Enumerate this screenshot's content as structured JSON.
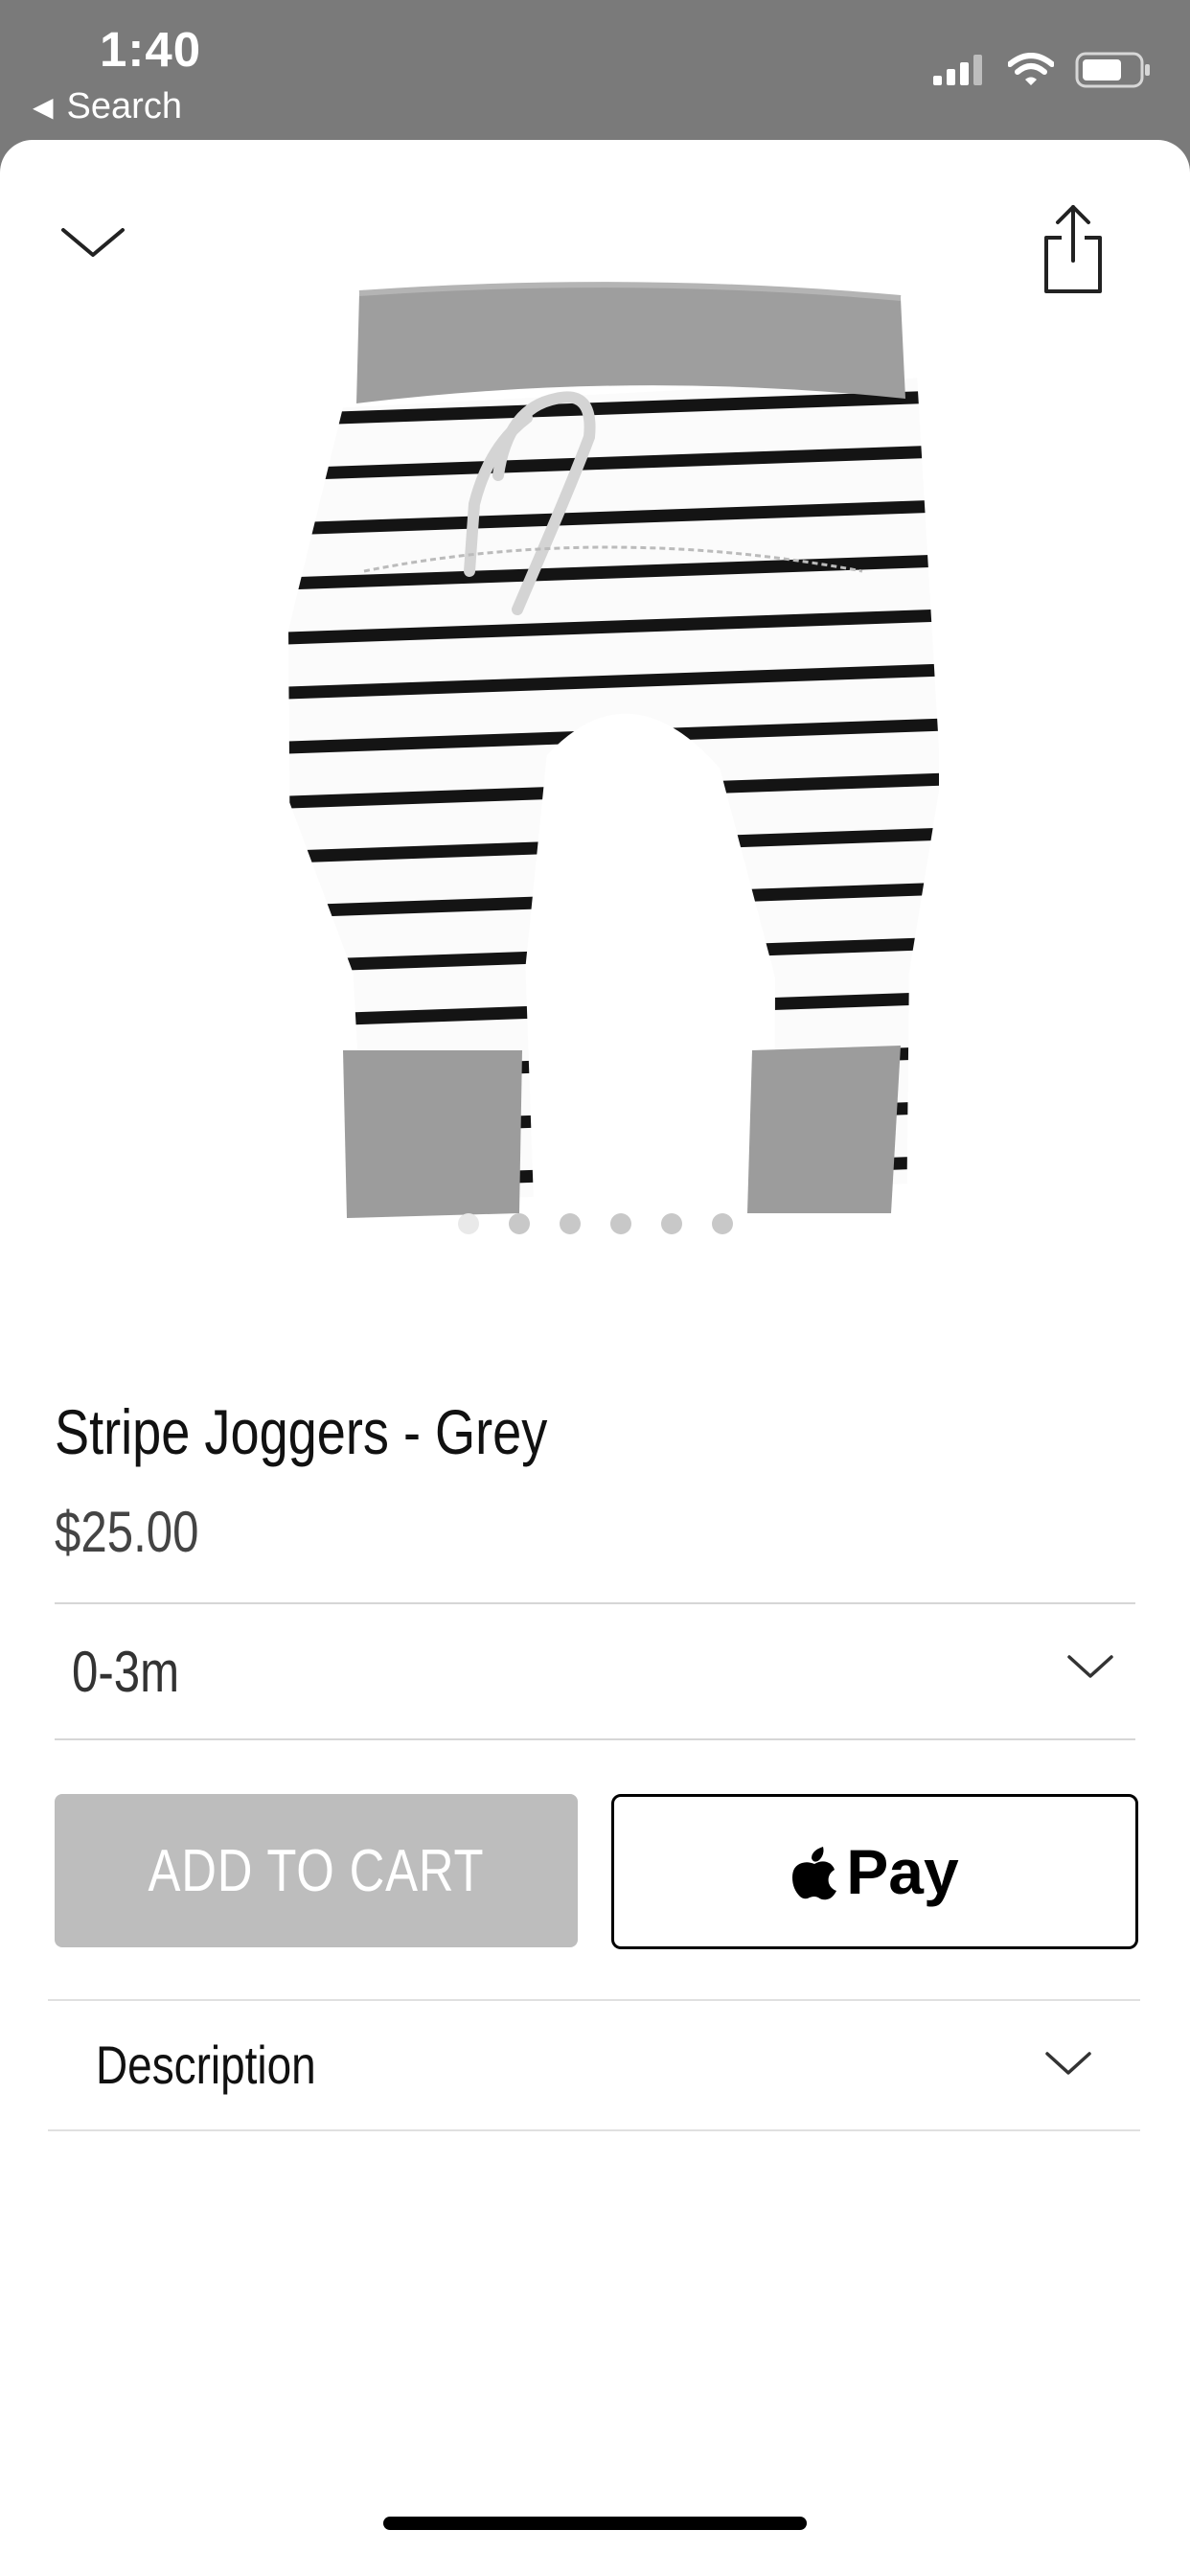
{
  "status_bar": {
    "time": "1:40",
    "back_label": "Search",
    "icons": [
      "signal-icon",
      "wifi-icon",
      "battery-icon"
    ]
  },
  "header": {
    "collapse_icon": "chevron-down-icon",
    "share_icon": "share-icon"
  },
  "gallery": {
    "image_count": 6,
    "active_index": 0
  },
  "product": {
    "title": "Stripe Joggers - Grey",
    "price": "$25.00"
  },
  "variant": {
    "selected": "0-3m"
  },
  "actions": {
    "add_to_cart": "ADD TO CART",
    "apple_pay": "Pay"
  },
  "description": {
    "label": "Description"
  },
  "colors": {
    "status_bg": "#7a7a7a",
    "add_to_cart_bg": "#bdbdbd",
    "text": "#111111"
  }
}
